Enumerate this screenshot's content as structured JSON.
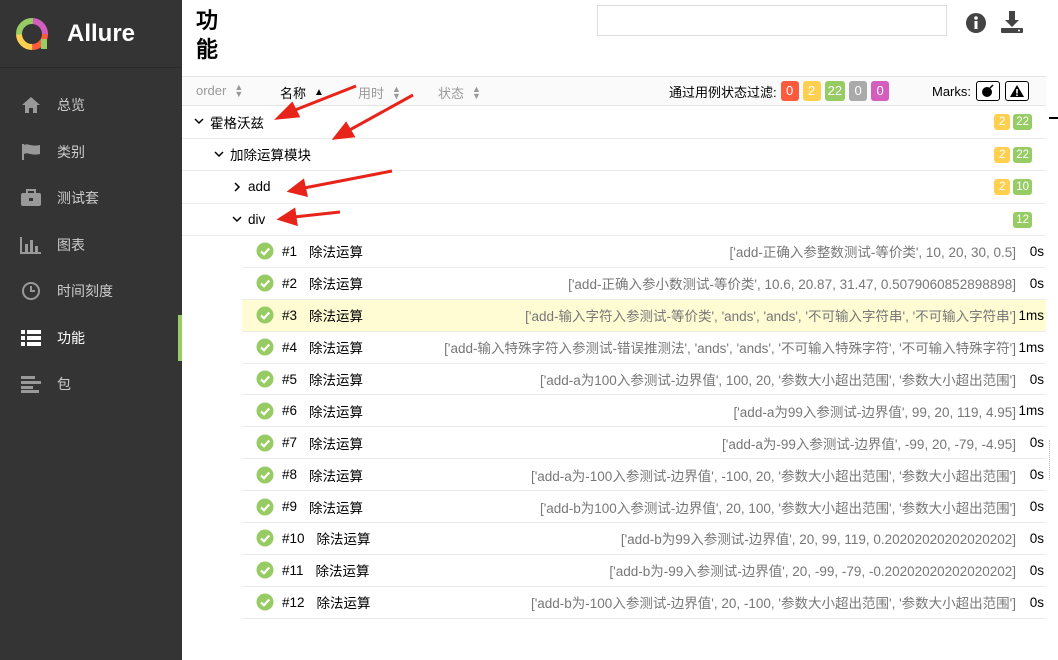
{
  "app": {
    "name": "Allure"
  },
  "nav": [
    {
      "label": "总览",
      "icon": "home-icon"
    },
    {
      "label": "类别",
      "icon": "flag-icon"
    },
    {
      "label": "测试套",
      "icon": "briefcase-icon"
    },
    {
      "label": "图表",
      "icon": "bar-chart-icon"
    },
    {
      "label": "时间刻度",
      "icon": "clock-icon"
    },
    {
      "label": "功能",
      "icon": "list-icon",
      "active": true
    },
    {
      "label": "包",
      "icon": "align-left-icon"
    }
  ],
  "page": {
    "title": "功能"
  },
  "search": {
    "value": "",
    "placeholder": ""
  },
  "toolbar": {
    "columns": [
      "order",
      "名称",
      "用时",
      "状态"
    ],
    "filter_label": "通过用例状态过滤:",
    "filter_counts": [
      "0",
      "2",
      "22",
      "0",
      "0"
    ],
    "marks_label": "Marks:"
  },
  "colors": {
    "failed": "#fd5a3e",
    "broken": "#ffd050",
    "passed": "#97cc64",
    "skipped": "#aaaaaa",
    "unknown": "#d35ebe",
    "sidebar": "#343434",
    "highlight": "#fffcd4"
  },
  "tree": {
    "root": {
      "label": "霍格沃兹",
      "broken": "2",
      "passed": "22"
    },
    "module": {
      "label": "加除运算模块",
      "broken": "2",
      "passed": "22"
    },
    "add": {
      "label": "add",
      "broken": "2",
      "passed": "10"
    },
    "div": {
      "label": "div",
      "passed": "12"
    }
  },
  "tests": [
    {
      "num": "#1",
      "name": "除法运算",
      "params": "['add-正确入参整数测试-等价类', 10, 20, 30, 0.5]",
      "duration": "0s"
    },
    {
      "num": "#2",
      "name": "除法运算",
      "params": "['add-正确入参小数测试-等价类', 10.6, 20.87, 31.47, 0.5079060852898898]",
      "duration": "0s"
    },
    {
      "num": "#3",
      "name": "除法运算",
      "params": "['add-输入字符入参测试-等价类', 'ands', 'ands', '不可输入字符串', '不可输入字符串']",
      "duration": "1ms",
      "highlight": true
    },
    {
      "num": "#4",
      "name": "除法运算",
      "params": "['add-输入特殊字符入参测试-错误推测法', 'ands', 'ands', '不可输入特殊字符', '不可输入特殊字符']",
      "duration": "1ms"
    },
    {
      "num": "#5",
      "name": "除法运算",
      "params": "['add-a为100入参测试-边界值', 100, 20, '参数大小超出范围', '参数大小超出范围']",
      "duration": "0s"
    },
    {
      "num": "#6",
      "name": "除法运算",
      "params": "['add-a为99入参测试-边界值', 99, 20, 119, 4.95]",
      "duration": "1ms"
    },
    {
      "num": "#7",
      "name": "除法运算",
      "params": "['add-a为-99入参测试-边界值', -99, 20, -79, -4.95]",
      "duration": "0s"
    },
    {
      "num": "#8",
      "name": "除法运算",
      "params": "['add-a为-100入参测试-边界值', -100, 20, '参数大小超出范围', '参数大小超出范围']",
      "duration": "0s"
    },
    {
      "num": "#9",
      "name": "除法运算",
      "params": "['add-b为100入参测试-边界值', 20, 100, '参数大小超出范围', '参数大小超出范围']",
      "duration": "0s"
    },
    {
      "num": "#10",
      "name": "除法运算",
      "params": "['add-b为99入参测试-边界值', 20, 99, 119, 0.20202020202020202]",
      "duration": "0s"
    },
    {
      "num": "#11",
      "name": "除法运算",
      "params": "['add-b为-99入参测试-边界值', 20, -99, -79, -0.20202020202020202]",
      "duration": "0s"
    },
    {
      "num": "#12",
      "name": "除法运算",
      "params": "['add-b为-100入参测试-边界值', 20, -100, '参数大小超出范围', '参数大小超出范围']",
      "duration": "0s"
    }
  ]
}
